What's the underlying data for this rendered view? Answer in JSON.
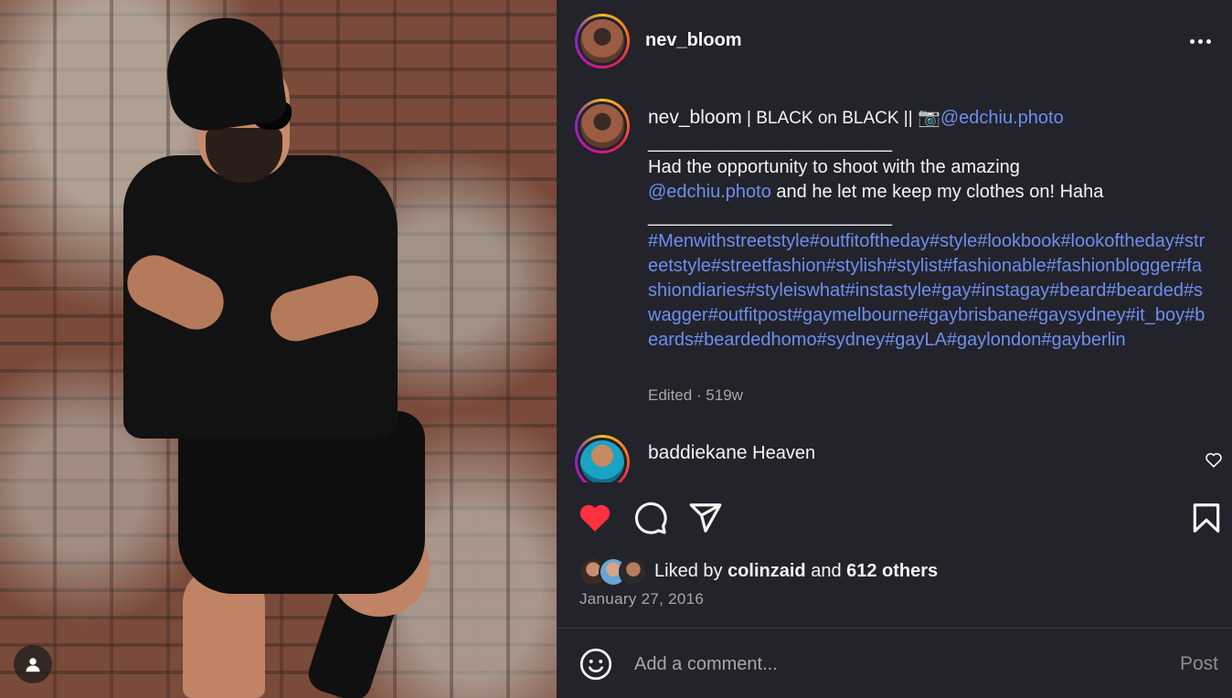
{
  "post": {
    "username": "nev_bloom",
    "caption": {
      "username": "nev_bloom",
      "title": " | BLACK on BLACK || ",
      "camera_emoji": "📷",
      "credit_mention": "@edchiu.photo",
      "rule1": "________________________",
      "line1": "Had the opportunity to shoot with the amazing",
      "mention2": "@edchiu.photo",
      "line2": " and he let me keep my clothes on! Haha",
      "rule2": "________________________",
      "hashtags": "#Menwithstreetstyle#outfitoftheday#style#lookbook#lookoftheday#streetstyle#streetfashion#stylish#stylist#fashionable#fashionblogger#fashiondiaries#styleiswhat#instastyle#gay#instagay#beard#bearded#swagger#outfitpost#gaymelbourne#gaybrisbane#gaysydney#it_boy#beards#beardedhomo#sydney#gayLA#gaylondon#gayberlin"
    },
    "meta": "Edited · 519w",
    "comment": {
      "username": "baddiekane",
      "text": " Heaven"
    },
    "likes": {
      "prefix": "Liked by ",
      "user": "colinzaid",
      "middle": " and ",
      "count": "612 others"
    },
    "date": "January 27, 2016",
    "comment_box": {
      "placeholder": "Add a comment...",
      "post_label": "Post"
    }
  },
  "colors": {
    "like_red": "#ff3040",
    "link_blue": "#6d8ff0",
    "panel_bg": "#23232b"
  },
  "icons": [
    "heart-icon",
    "comment-icon",
    "share-icon",
    "bookmark-icon",
    "more-icon",
    "emoji-icon",
    "user-icon"
  ]
}
